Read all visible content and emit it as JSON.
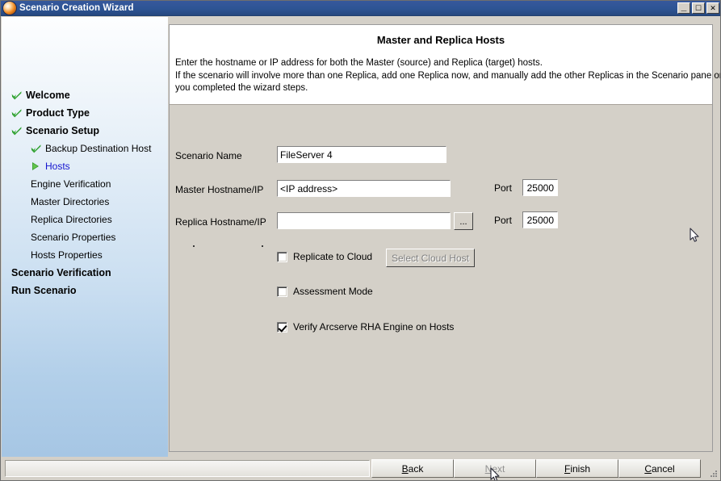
{
  "window": {
    "title": "Scenario Creation Wizard",
    "icon": "arcserve-logo-icon",
    "buttons": {
      "minimize": "_",
      "maximize": "☐",
      "close": "✕"
    }
  },
  "sidebar": {
    "items": [
      {
        "label": "Welcome",
        "level": "top",
        "state": "done"
      },
      {
        "label": "Product Type",
        "level": "top",
        "state": "done"
      },
      {
        "label": "Scenario Setup",
        "level": "top",
        "state": "done"
      },
      {
        "label": "Backup Destination Host",
        "level": "sub",
        "state": "done"
      },
      {
        "label": "Hosts",
        "level": "sub",
        "state": "active"
      },
      {
        "label": "Engine Verification",
        "level": "sub",
        "state": "pending"
      },
      {
        "label": "Master Directories",
        "level": "sub",
        "state": "pending"
      },
      {
        "label": "Replica Directories",
        "level": "sub",
        "state": "pending"
      },
      {
        "label": "Scenario Properties",
        "level": "sub",
        "state": "pending"
      },
      {
        "label": "Hosts Properties",
        "level": "sub",
        "state": "pending"
      },
      {
        "label": "Scenario Verification",
        "level": "top",
        "state": "pending"
      },
      {
        "label": "Run Scenario",
        "level": "top",
        "state": "pending"
      }
    ]
  },
  "content": {
    "heading": "Master and Replica Hosts",
    "description": [
      "Enter the hostname or IP address for both the Master (source) and Replica (target) hosts.",
      "If the scenario will involve more than one Replica, add one Replica now, and manually add the other Replicas in the Scenario pane once",
      "you completed the wizard steps."
    ],
    "fields": {
      "scenario_name": {
        "label": "Scenario Name",
        "value": "FileServer 4"
      },
      "master_host": {
        "label": "Master Hostname/IP",
        "value": "<IP address>",
        "port_label": "Port",
        "port_value": "25000"
      },
      "replica_host": {
        "label": "Replica Hostname/IP",
        "value": "",
        "browse_label": "...",
        "port_label": "Port",
        "port_value": "25000"
      }
    },
    "options": {
      "replicate_to_cloud": {
        "label": "Replicate to Cloud",
        "checked": false
      },
      "select_cloud_host": {
        "label": "Select Cloud Host",
        "enabled": false
      },
      "assessment_mode": {
        "label": "Assessment Mode",
        "checked": false
      },
      "verify_engine": {
        "label": "Verify Arcserve RHA Engine on Hosts",
        "checked": true
      }
    }
  },
  "footer": {
    "status": "",
    "buttons": [
      {
        "label": "Back",
        "accel": "B",
        "enabled": true
      },
      {
        "label": "Next",
        "accel": "N",
        "enabled": false
      },
      {
        "label": "Finish",
        "accel": "F",
        "enabled": true
      },
      {
        "label": "Cancel",
        "accel": "C",
        "enabled": true
      }
    ]
  },
  "colors": {
    "titlebar": "#2d5494",
    "form_background": "#d4d0c8",
    "active_link": "#1414cf",
    "check_green": "#2ca02c",
    "sidebar_bottom": "#a6c6e4"
  }
}
